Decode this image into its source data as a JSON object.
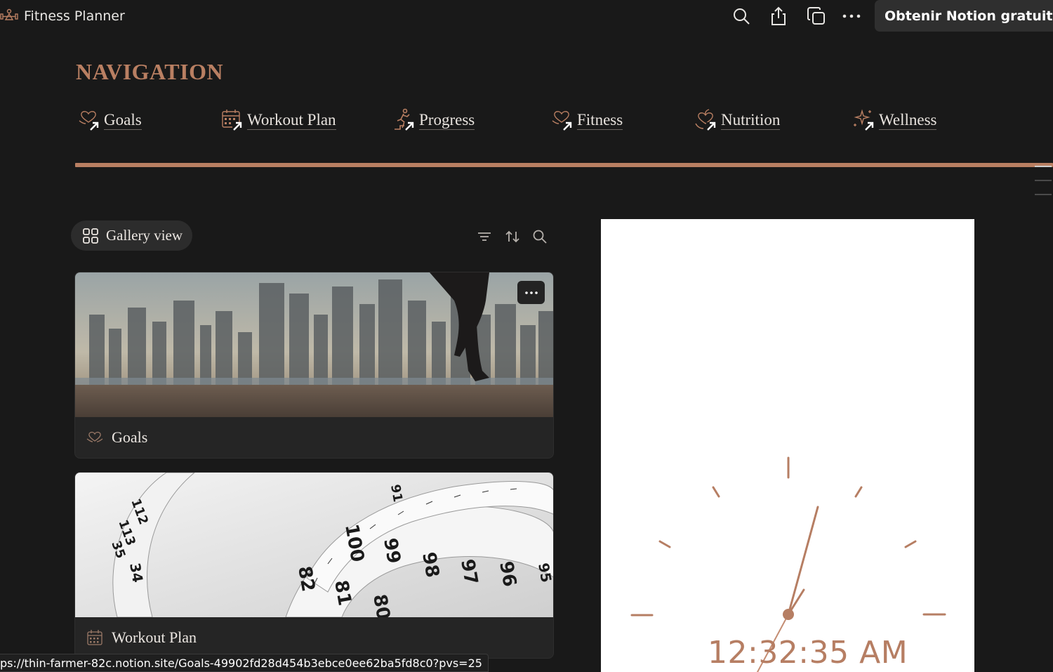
{
  "topbar": {
    "title": "Fitness Planner",
    "title_icon": "gym-icon",
    "actions": [
      "search-icon",
      "share-icon",
      "duplicate-icon",
      "more-icon"
    ],
    "cta_label": "Obtenir Notion gratuitement"
  },
  "navigation": {
    "heading": "NAVIGATION",
    "links": [
      {
        "label": "Goals",
        "icon": "heart-hands-icon"
      },
      {
        "label": "Workout Plan",
        "icon": "calendar-icon"
      },
      {
        "label": "Progress",
        "icon": "runner-icon"
      },
      {
        "label": "Fitness",
        "icon": "heart-hands-icon"
      },
      {
        "label": "Nutrition",
        "icon": "heart-leaf-icon"
      },
      {
        "label": "Wellness",
        "icon": "sparkle-icon"
      }
    ]
  },
  "gallery": {
    "view_label": "Gallery view",
    "tools": [
      "filter-icon",
      "sort-icon",
      "search-icon"
    ],
    "cards": [
      {
        "title": "Goals",
        "icon": "heart-hands-icon",
        "cover": "city-runner-photo"
      },
      {
        "title": "Workout Plan",
        "icon": "calendar-icon",
        "cover": "measuring-tape-photo"
      }
    ],
    "tape_numbers": [
      "112",
      "113",
      "35",
      "34",
      "91",
      "95",
      "100",
      "99",
      "98",
      "97",
      "96",
      "82",
      "81",
      "80"
    ]
  },
  "clock": {
    "time": "12:32:35 AM"
  },
  "status_bar": {
    "url": "ps://thin-farmer-82c.notion.site/Goals-49902fd28d454b3ebce0ee62ba5fd8c0?pvs=25"
  },
  "colors": {
    "accent": "#b97f62",
    "background": "#191919",
    "card": "#252525"
  }
}
